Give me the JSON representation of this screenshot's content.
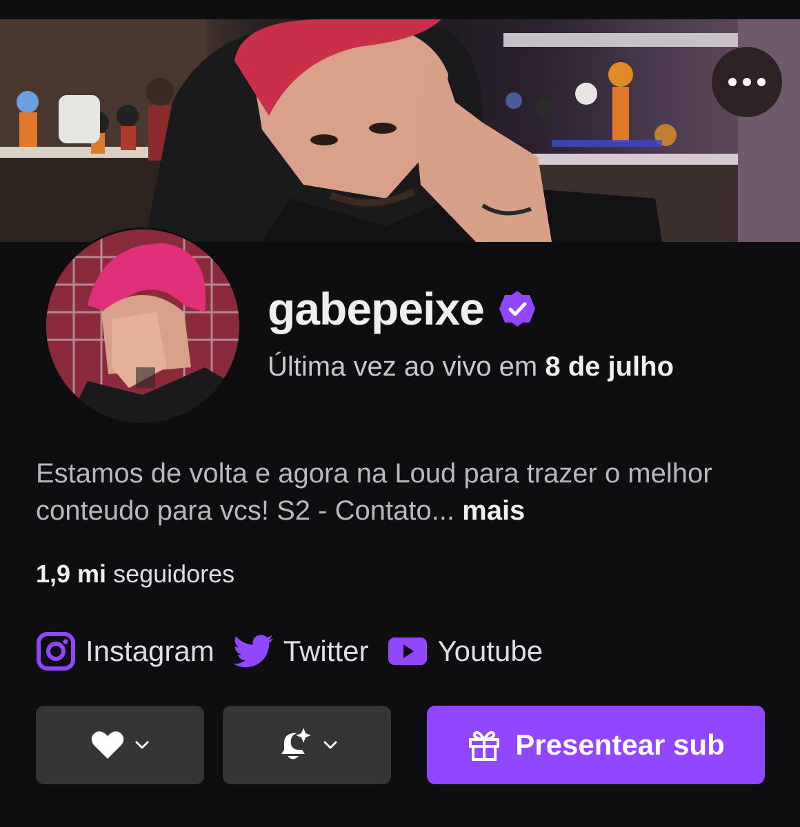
{
  "banner": {
    "more_options_icon": "more-horizontal-icon"
  },
  "profile": {
    "username": "gabepeixe",
    "verified_icon": "verified-badge-icon",
    "last_live_prefix": "Última vez ao vivo em ",
    "last_live_date": "8 de julho",
    "bio": "Estamos de volta e agora na Loud para trazer o melhor conteudo para vcs! S2 - Contato... ",
    "bio_more": "mais",
    "followers_count": "1,9 mi",
    "followers_label": " seguidores"
  },
  "socials": [
    {
      "label": "Instagram",
      "icon": "instagram-icon"
    },
    {
      "label": "Twitter",
      "icon": "twitter-icon"
    },
    {
      "label": "Youtube",
      "icon": "youtube-icon"
    }
  ],
  "actions": {
    "follow_icon": "heart-icon",
    "notifications_icon": "bell-sparkle-icon",
    "gift_icon": "gift-icon",
    "gift_label": "Presentear sub"
  },
  "colors": {
    "background": "#0e0e10",
    "accent": "#9147ff",
    "button_gray": "#353538",
    "text_primary": "#efeff1",
    "text_secondary": "#b8b8bf"
  }
}
